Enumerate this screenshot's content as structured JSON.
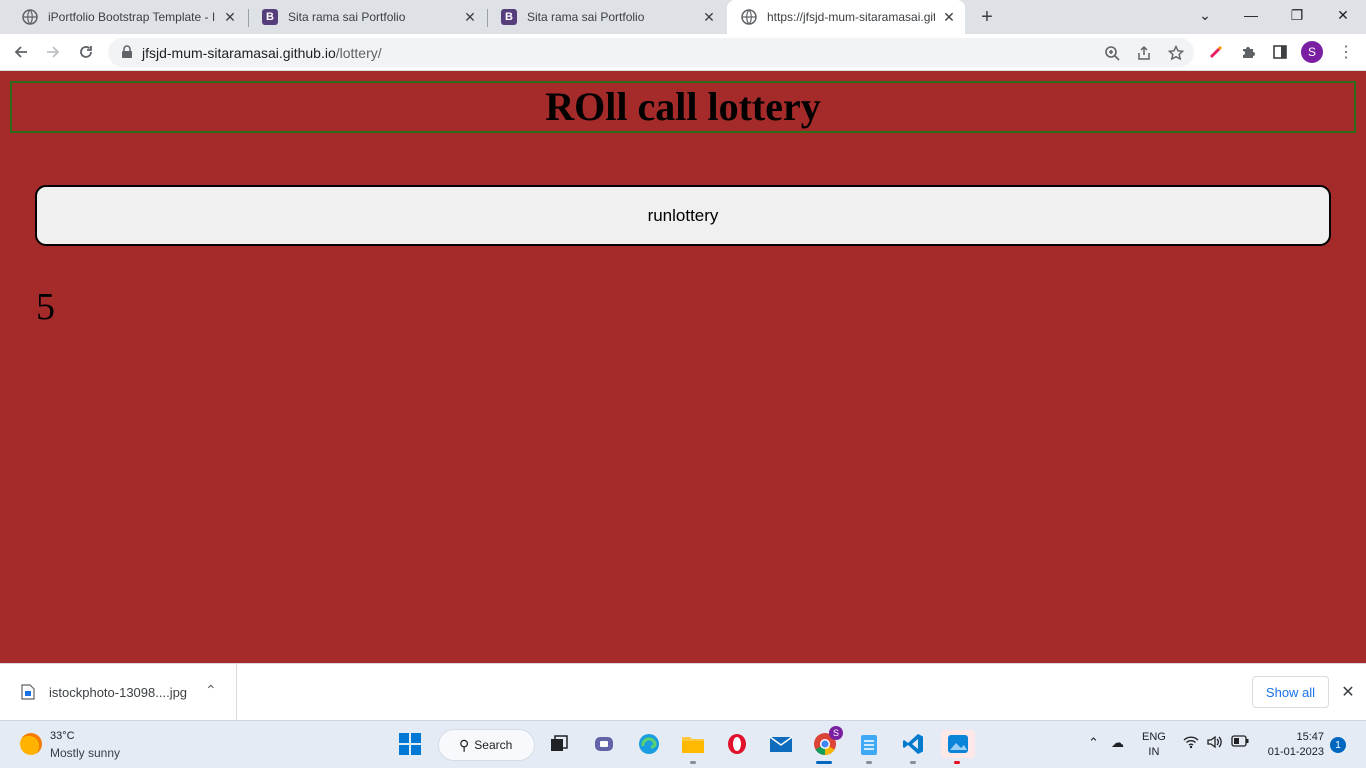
{
  "browser": {
    "tabs": [
      {
        "title": "iPortfolio Bootstrap Template - In",
        "favicon": "globe-icon"
      },
      {
        "title": "Sita rama sai Portfolio",
        "favicon": "bootstrap-icon"
      },
      {
        "title": "Sita rama sai Portfolio",
        "favicon": "bootstrap-icon"
      },
      {
        "title": "https://jfsjd-mum-sitaramasai.git",
        "favicon": "globe-icon",
        "active": true
      }
    ],
    "url_host": "jfsjd-mum-sitaramasai.github.io",
    "url_path": "/lottery/",
    "profile_initial": "S"
  },
  "page": {
    "heading": "ROll call lottery",
    "button_label": "runlottery",
    "result": "5",
    "background": "#a52a2a"
  },
  "downloads": {
    "file_name": "istockphoto-13098....jpg",
    "show_all": "Show all"
  },
  "taskbar": {
    "temperature": "33°C",
    "condition": "Mostly sunny",
    "search_label": "Search",
    "language": "ENG",
    "region": "IN",
    "time": "15:47",
    "date": "01-01-2023",
    "notifications": "1",
    "chrome_badge": "S"
  }
}
